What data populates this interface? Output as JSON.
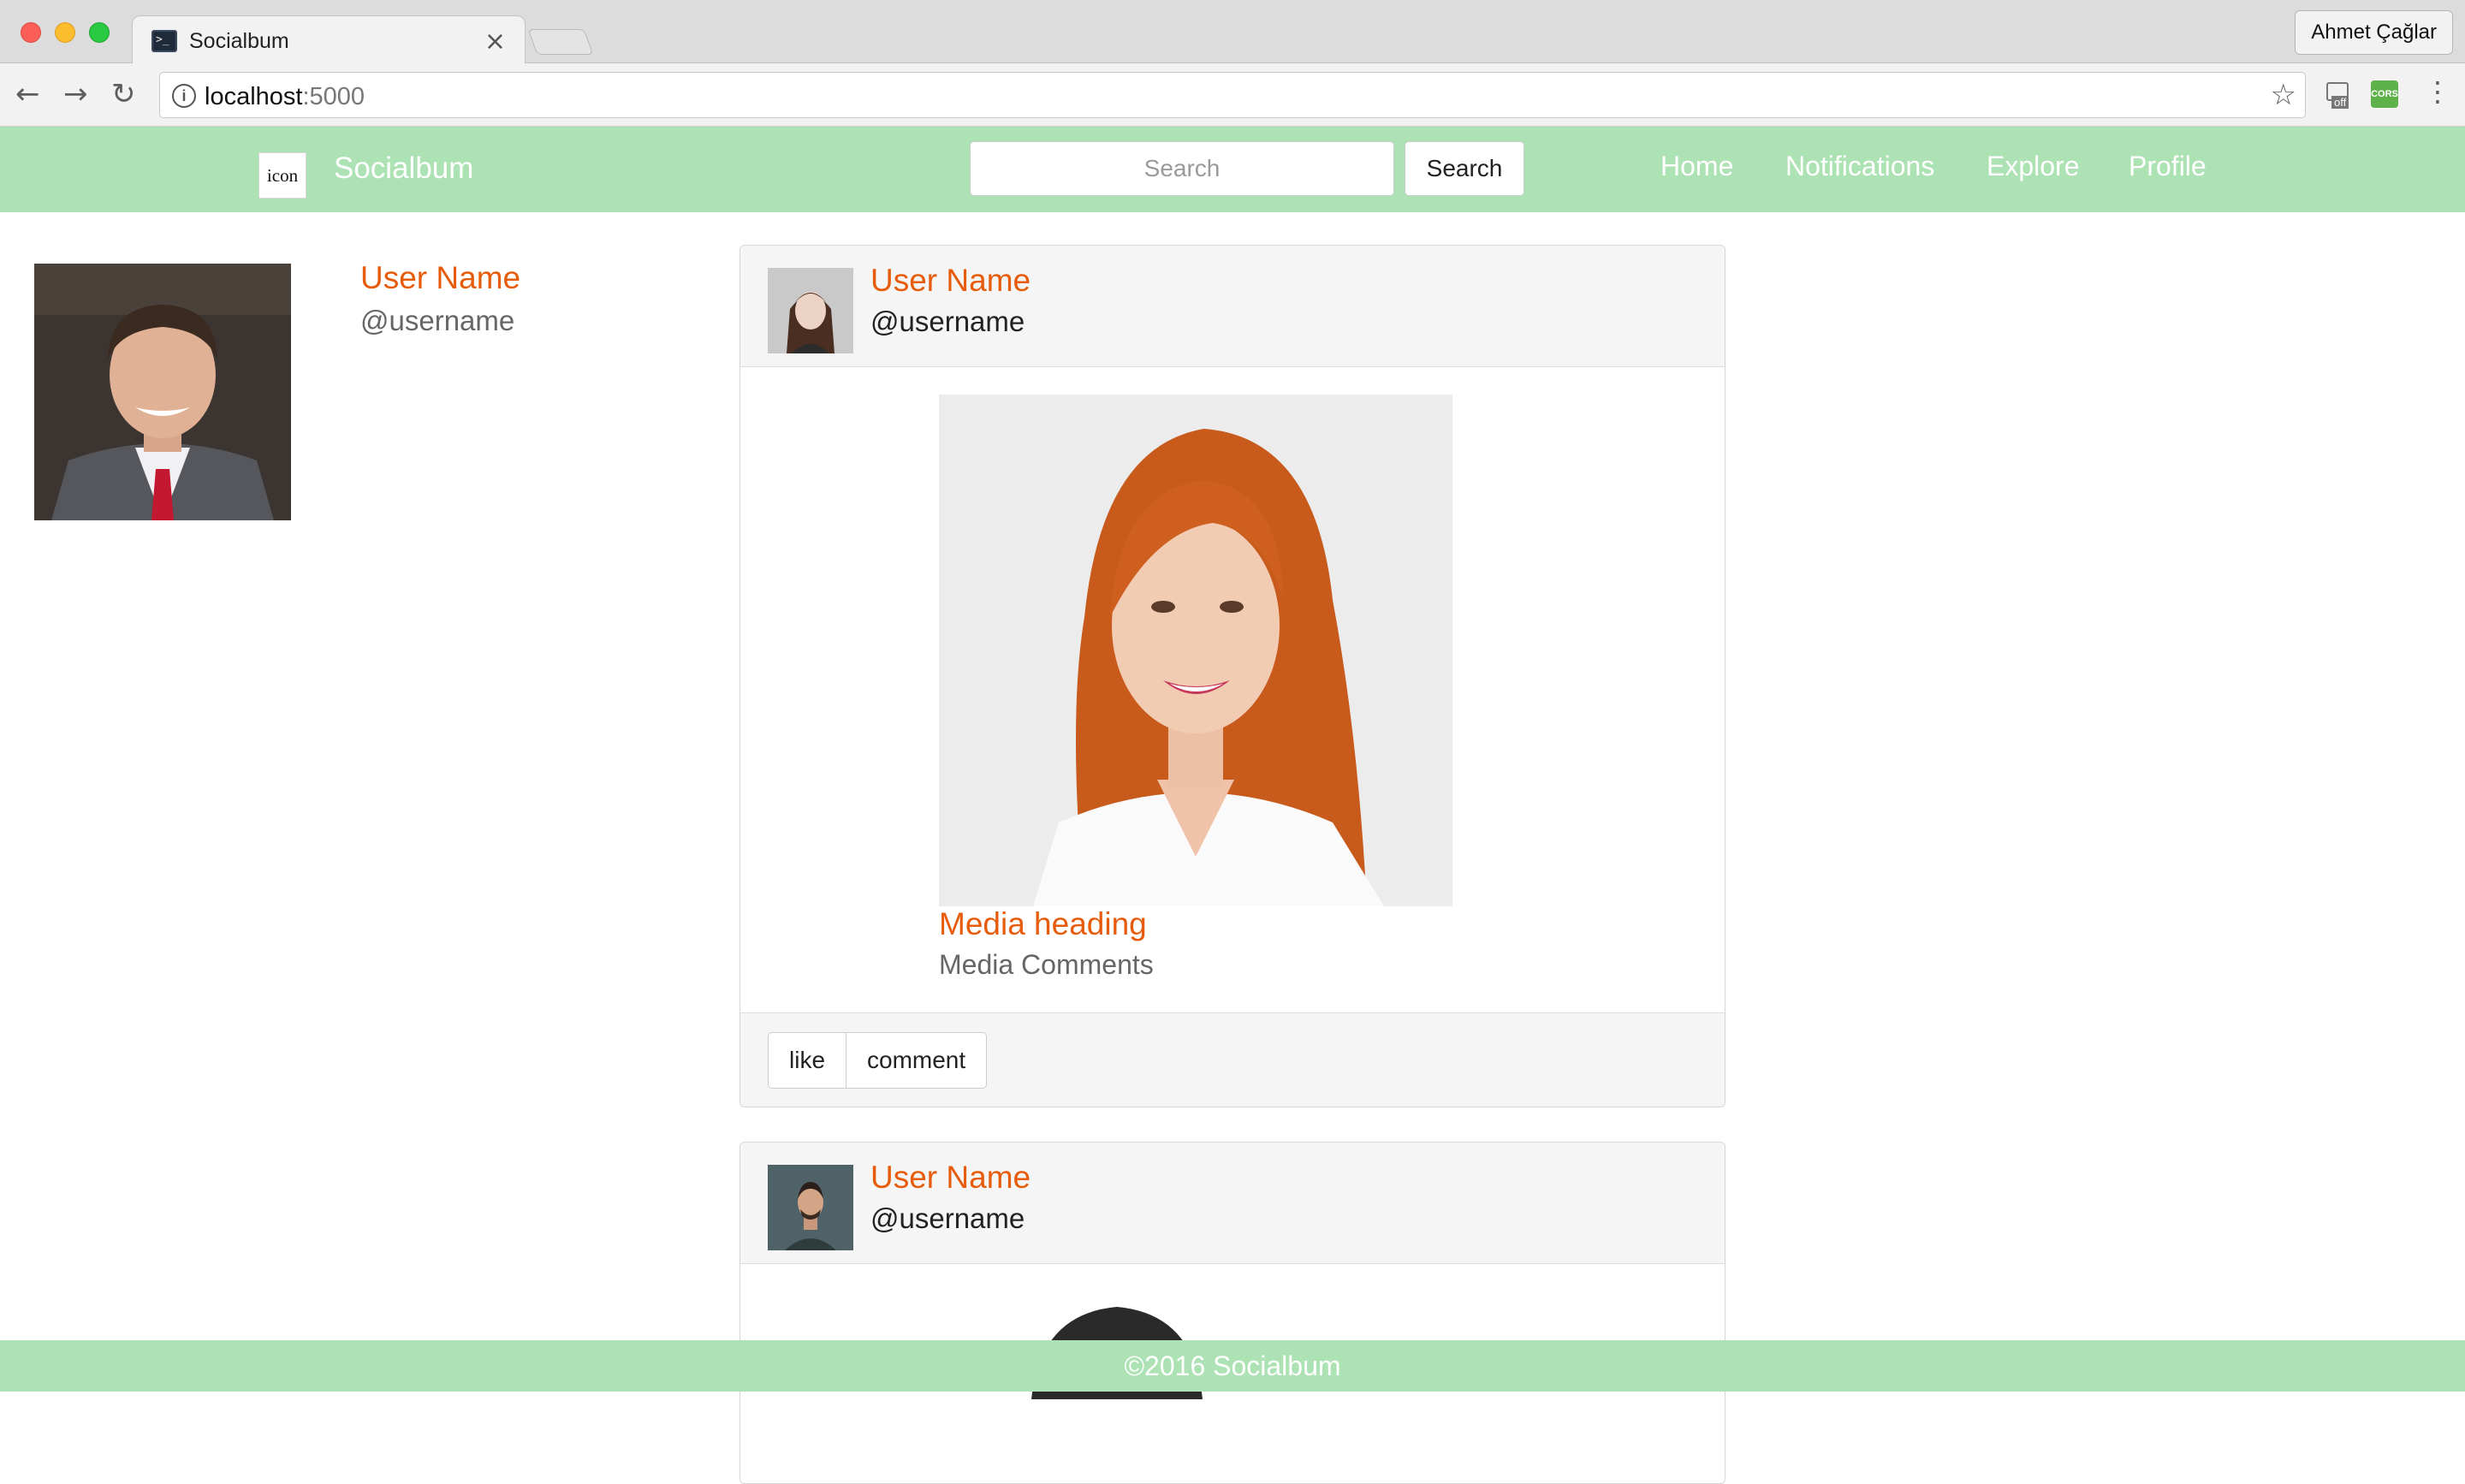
{
  "browser": {
    "tab_title": "Socialbum",
    "tab_close": "×",
    "profile_name": "Ahmet Çağlar",
    "url_host": "localhost",
    "url_port": ":5000",
    "extension_cors_label": "CORS",
    "extension_off_label": "off"
  },
  "nav": {
    "brand_icon_text": "icon",
    "brand_name": "Socialbum",
    "search_placeholder": "Search",
    "search_button": "Search",
    "links": [
      "Home",
      "Notifications",
      "Explore",
      "Profile"
    ]
  },
  "sidebar": {
    "name": "User Name",
    "handle": "@username"
  },
  "posts": [
    {
      "name": "User Name",
      "handle": "@username",
      "media_heading": "Media heading",
      "media_comments": "Media Comments",
      "like_label": "like",
      "comment_label": "comment"
    },
    {
      "name": "User Name",
      "handle": "@username"
    }
  ],
  "footer": {
    "text": "©2016 Socialbum"
  },
  "colors": {
    "accent": "#e65c0b",
    "nav_bg": "#ade3b4"
  }
}
